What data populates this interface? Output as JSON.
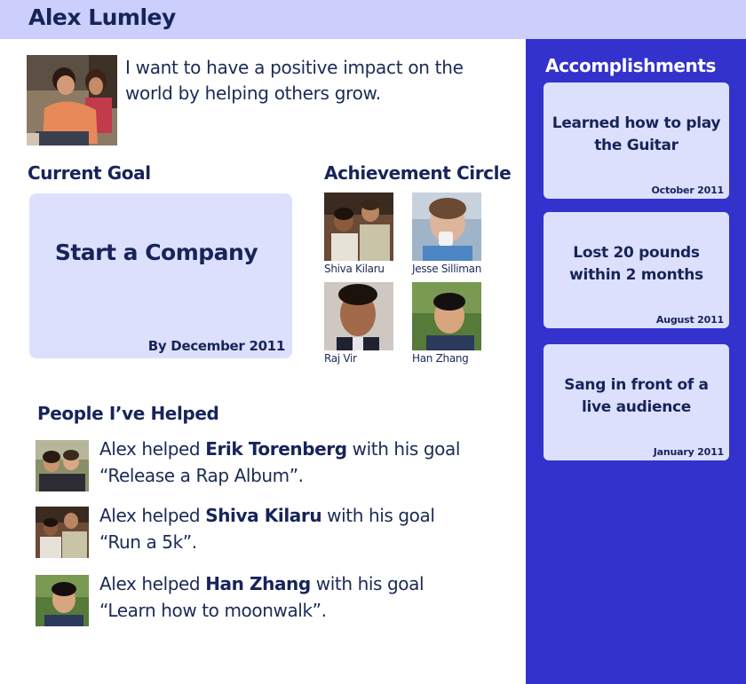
{
  "header": {
    "name": "Alex Lumley"
  },
  "profile": {
    "bio": "I want to have a positive impact on the world by helping others grow."
  },
  "current_goal": {
    "heading": "Current Goal",
    "goal": "Start a Company",
    "deadline": "By December 2011"
  },
  "achievement_circle": {
    "heading": "Achievement Circle",
    "members": [
      {
        "name": "Shiva Kilaru"
      },
      {
        "name": "Jesse Silliman"
      },
      {
        "name": "Raj Vir"
      },
      {
        "name": "Han Zhang"
      }
    ]
  },
  "people_helped": {
    "heading": "People I’ve Helped",
    "entries": [
      {
        "prefix": "Alex helped ",
        "person": "Erik Torenberg",
        "middle": " with his goal",
        "goal": "“Release a Rap Album”."
      },
      {
        "prefix": "Alex helped ",
        "person": "Shiva Kilaru",
        "middle": " with his goal",
        "goal": "“Run a 5k”."
      },
      {
        "prefix": "Alex helped ",
        "person": "Han Zhang",
        "middle": " with his goal",
        "goal": "“Learn how to moonwalk”."
      }
    ]
  },
  "accomplishments": {
    "heading": "Accomplishments",
    "items": [
      {
        "text": "Learned how to play the Guitar",
        "date": "October 2011"
      },
      {
        "text": "Lost 20 pounds within 2 months",
        "date": "August 2011"
      },
      {
        "text": "Sang in front of a live audience",
        "date": "January 2011"
      }
    ]
  },
  "colors": {
    "header_bg": "#cccffb",
    "sidebar_bg": "#3332cc",
    "card_bg": "#dde0fc",
    "text_dark": "#17245a"
  }
}
